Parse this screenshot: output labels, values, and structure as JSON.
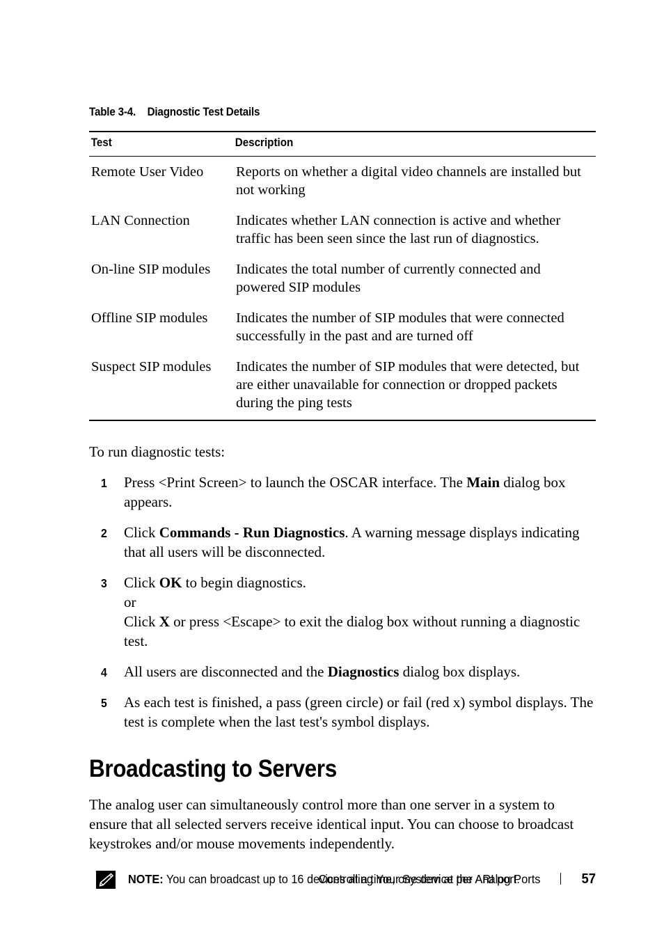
{
  "table": {
    "number_label": "Table 3-4.",
    "caption": "Diagnostic Test Details",
    "columns": [
      "Test",
      "Description"
    ],
    "rows": [
      {
        "test": "Remote User Video",
        "description": "Reports on whether a digital video channels are installed but not working"
      },
      {
        "test": "LAN Connection",
        "description": "Indicates whether LAN connection is active and whether traffic has been seen since the last run of diagnostics."
      },
      {
        "test": "On-line SIP modules",
        "description": "Indicates the total number of currently connected and powered SIP modules"
      },
      {
        "test": "Offline SIP modules",
        "description": "Indicates the number of SIP modules that were connected successfully in the past and are turned off"
      },
      {
        "test": "Suspect SIP modules",
        "description": "Indicates the number of SIP modules that were detected, but are either unavailable for connection or dropped packets during the ping tests"
      }
    ]
  },
  "procedure": {
    "lead_in": "To run diagnostic tests:",
    "steps": [
      {
        "number": "1",
        "parts": [
          {
            "text": "Press <Print Screen> to launch the OSCAR interface. The ",
            "bold": false
          },
          {
            "text": "Main",
            "bold": true
          },
          {
            "text": " dialog box appears.",
            "bold": false
          }
        ]
      },
      {
        "number": "2",
        "parts": [
          {
            "text": "Click ",
            "bold": false
          },
          {
            "text": "Commands - Run Diagnostics",
            "bold": true
          },
          {
            "text": ". A warning message displays indicating that all users will be disconnected.",
            "bold": false
          }
        ]
      },
      {
        "number": "3",
        "parts": [
          {
            "text": "Click ",
            "bold": false
          },
          {
            "text": "OK",
            "bold": true
          },
          {
            "text": " to begin diagnostics.",
            "bold": false
          },
          {
            "text": "or",
            "bold": false,
            "newline": true
          },
          {
            "text": "Click ",
            "bold": false,
            "newline": true
          },
          {
            "text": "X",
            "bold": true
          },
          {
            "text": " or press <Escape> to exit the dialog box without running a diagnostic test.",
            "bold": false
          }
        ]
      },
      {
        "number": "4",
        "parts": [
          {
            "text": "All users are disconnected and the ",
            "bold": false
          },
          {
            "text": "Diagnostics",
            "bold": true
          },
          {
            "text": " dialog box displays.",
            "bold": false
          }
        ]
      },
      {
        "number": "5",
        "parts": [
          {
            "text": "As each test is finished, a pass (green circle) or fail (red x) symbol displays. The test is complete when the last test's symbol displays.",
            "bold": false
          }
        ]
      }
    ]
  },
  "section": {
    "heading": "Broadcasting to Servers",
    "paragraph": "The analog user can simultaneously control more than one server in a system to ensure that all selected servers receive identical input. You can choose to broadcast keystrokes and/or mouse movements independently."
  },
  "note": {
    "icon": "note-pencil-icon",
    "label": "NOTE:",
    "text": "You can broadcast up to 16 devices at a time, one device per ARI port."
  },
  "footer": {
    "title": "Controlling Your System at the Analog Ports",
    "page_number": "57"
  }
}
